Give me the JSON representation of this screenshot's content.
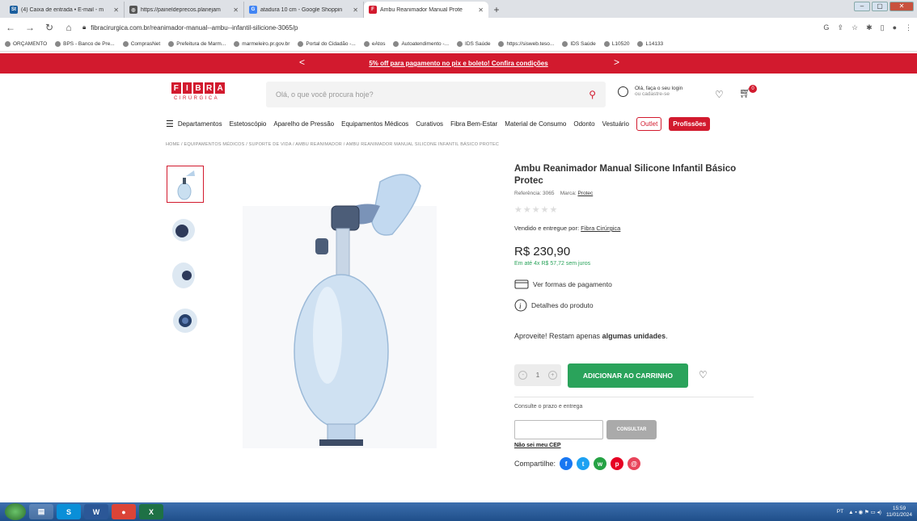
{
  "browser": {
    "tabs": [
      {
        "title": "(4) Caixa de entrada • E-mail - m",
        "favicon": "St",
        "color": "#1b5e9e"
      },
      {
        "title": "https://paineldeprecos.planejam",
        "favicon": "◎",
        "color": "#555555"
      },
      {
        "title": "atadura 10 cm - Google Shoppin",
        "favicon": "G",
        "color": "#4285f4"
      },
      {
        "title": "Ambu Reanimador Manual Prote",
        "favicon": "F",
        "color": "#d21a2e",
        "active": true
      }
    ],
    "url": "fibracirurgica.com.br/reanimador-manual--ambu--infantil-silicione-3065/p",
    "bookmarks": [
      "ORÇAMENTO",
      "BPS - Banco de Pre...",
      "ComprasNet",
      "Prefeitura de Marm...",
      "marmeleiro.pr.gov.br",
      "Portal do Cidadão -...",
      "eAtos",
      "Autoatendimento -...",
      "IDS Saúde",
      "https://sisweb.teso...",
      "IDS Saúde",
      "L10520",
      "L14133"
    ]
  },
  "promo": {
    "text": "5% off para pagamento no pix e boleto! Confira condições",
    "prev": "<",
    "next": ">"
  },
  "header": {
    "logo_letters": [
      "F",
      "I",
      "B",
      "R",
      "A"
    ],
    "logo_sub": "CIRÚRGICA",
    "search_placeholder": "Olá, o que você procura hoje?",
    "login_line1": "Olá, faça o seu login",
    "login_line2": "ou cadastre-se",
    "cart_count": "0"
  },
  "nav": {
    "items": [
      "Departamentos",
      "Estetoscópio",
      "Aparelho de Pressão",
      "Equipamentos Médicos",
      "Curativos",
      "Fibra Bem-Estar",
      "Material de Consumo",
      "Odonto",
      "Vestuário"
    ],
    "outlet": "Outlet",
    "profissoes": "Profissões"
  },
  "breadcrumb": "HOME  /  EQUIPAMENTOS MÉDICOS  /  SUPORTE DE VIDA  /  AMBU REANIMADOR  /  AMBU REANIMADOR MANUAL SILICONE INFANTIL BÁSICO PROTEC",
  "product": {
    "title": "Ambu Reanimador Manual Silicone Infantil Básico Protec",
    "reference_label": "Referência: 3065",
    "brand_label": "Marca:",
    "brand": "Protec",
    "rating_stars": "★★★★★",
    "seller_label": "Vendido e entregue por:",
    "seller": "Fibra Cirúrgica",
    "price": "R$ 230,90",
    "installments": "Em até 4x R$ 57,72 sem juros",
    "payment_link": "Ver formas de pagamento",
    "details_link": "Detalhes do produto",
    "stock_prefix": "Aproveite! Restam apenas",
    "stock_bold": "algumas unidades",
    "stock_suffix": ".",
    "quantity": "1",
    "qty_minus": "-",
    "qty_plus": "+",
    "add_to_cart": "ADICIONAR AO CARRINHO",
    "shipping_label": "Consulte o prazo e entrega",
    "consult_button": "CONSULTAR",
    "no_cep": "Não sei meu CEP",
    "share_label": "Compartilhe:"
  },
  "social": [
    {
      "name": "facebook",
      "glyph": "f",
      "color": "#1877f2"
    },
    {
      "name": "twitter",
      "glyph": "t",
      "color": "#1da1f2"
    },
    {
      "name": "whatsapp",
      "glyph": "w",
      "color": "#25a244"
    },
    {
      "name": "pinterest",
      "glyph": "p",
      "color": "#e60023"
    },
    {
      "name": "email",
      "glyph": "@",
      "color": "#e8445a"
    }
  ],
  "taskbar": {
    "apps": [
      "S",
      "W",
      "●",
      "X"
    ],
    "lang": "PT",
    "time": "15:59",
    "date": "11/01/2024"
  }
}
